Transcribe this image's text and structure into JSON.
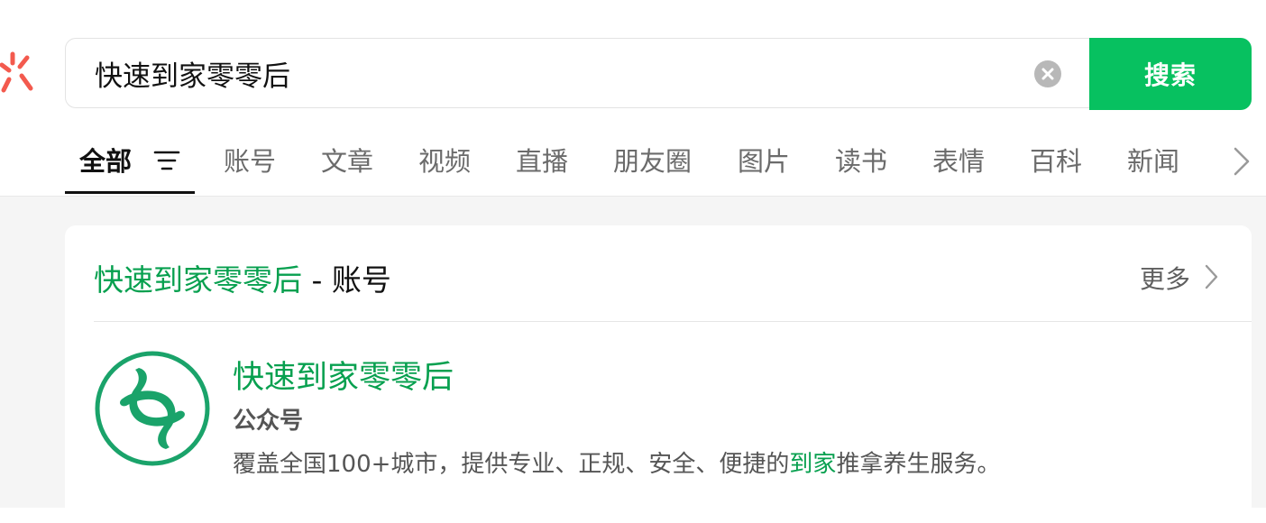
{
  "colors": {
    "brand_green": "#07c160",
    "highlight_green": "#07a04f",
    "logo_red": "#f35a4e"
  },
  "header": {
    "logo_icon": "wechat-search-logo",
    "search": {
      "value": "快速到家零零后",
      "clear_icon": "clear-circle-icon",
      "button_label": "搜索"
    }
  },
  "tabs": {
    "active": "全部",
    "filter_icon": "filter-lines-icon",
    "next_icon": "chevron-right-icon",
    "items": [
      {
        "label": "全部"
      },
      {
        "label": "账号"
      },
      {
        "label": "文章"
      },
      {
        "label": "视频"
      },
      {
        "label": "直播"
      },
      {
        "label": "朋友圈"
      },
      {
        "label": "图片"
      },
      {
        "label": "读书"
      },
      {
        "label": "表情"
      },
      {
        "label": "百科"
      },
      {
        "label": "新闻"
      }
    ]
  },
  "results": {
    "section": {
      "title_highlight": "快速到家零零后",
      "title_suffix": " - 账号",
      "more_label": "更多"
    },
    "account": {
      "avatar_icon": "hands-logo-avatar",
      "name": "快速到家零零后",
      "type": "公众号",
      "description_before": "覆盖全国100+城市，提供专业、正规、安全、便捷的",
      "description_highlight": "到家",
      "description_after": "推拿养生服务。"
    }
  }
}
